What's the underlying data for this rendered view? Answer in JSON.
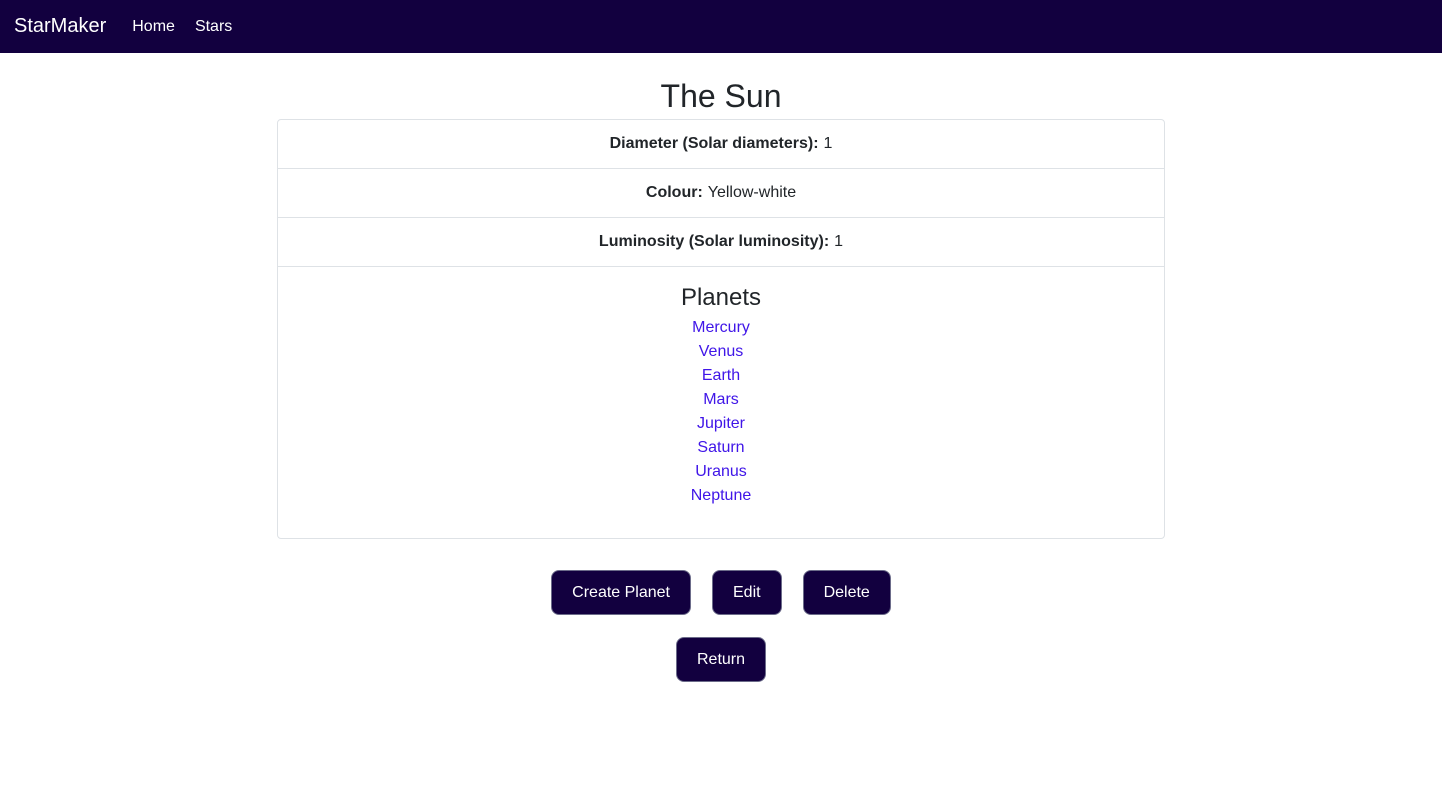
{
  "colors": {
    "navbar_bg": "#12003f",
    "button_bg": "#12003f",
    "link": "#4016e8"
  },
  "navbar": {
    "brand": "StarMaker",
    "links": [
      "Home",
      "Stars"
    ]
  },
  "star": {
    "name": "The Sun",
    "properties": [
      {
        "label": "Diameter (Solar diameters):",
        "value": "1"
      },
      {
        "label": "Colour:",
        "value": "Yellow-white"
      },
      {
        "label": "Luminosity (Solar luminosity):",
        "value": "1"
      }
    ]
  },
  "planets": {
    "heading": "Planets",
    "items": [
      "Mercury",
      "Venus",
      "Earth",
      "Mars",
      "Jupiter",
      "Saturn",
      "Uranus",
      "Neptune"
    ]
  },
  "actions": {
    "create_planet": "Create Planet",
    "edit": "Edit",
    "delete": "Delete",
    "return": "Return"
  }
}
